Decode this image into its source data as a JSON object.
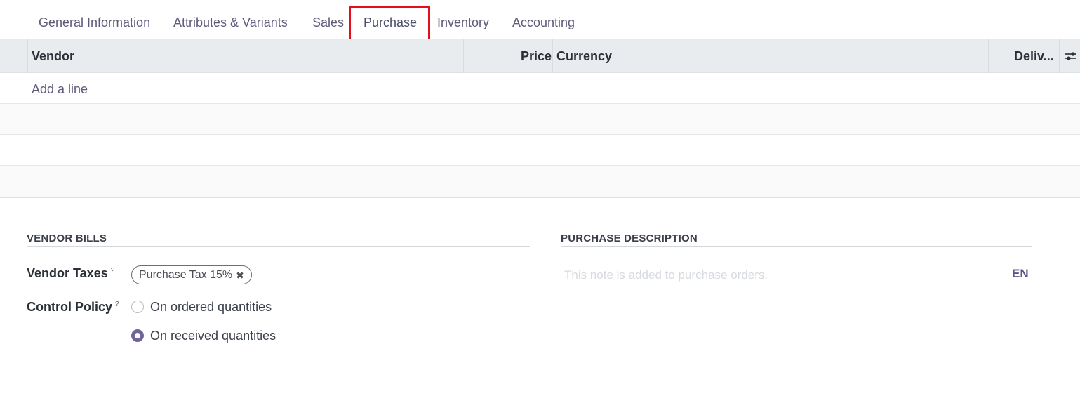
{
  "tabs": [
    {
      "label": "General Information"
    },
    {
      "label": "Attributes & Variants"
    },
    {
      "label": "Sales"
    },
    {
      "label": "Purchase"
    },
    {
      "label": "Inventory"
    },
    {
      "label": "Accounting"
    }
  ],
  "active_tab": "Purchase",
  "table": {
    "columns": [
      "Vendor",
      "Price",
      "Currency",
      "Deliv..."
    ],
    "add_line": "Add a line",
    "settings_icon": "sliders-icon"
  },
  "vendor_bills": {
    "title": "VENDOR BILLS",
    "vendor_taxes": {
      "label": "Vendor Taxes",
      "help": "?",
      "tags": [
        "Purchase Tax 15%"
      ]
    },
    "control_policy": {
      "label": "Control Policy",
      "help": "?",
      "options": [
        "On ordered quantities",
        "On received quantities"
      ],
      "selected": "On received quantities"
    }
  },
  "purchase_description": {
    "title": "PURCHASE DESCRIPTION",
    "placeholder": "This note is added to purchase orders.",
    "lang": "EN"
  },
  "colors": {
    "accent": "#71639e",
    "highlight": "#e3101c"
  }
}
